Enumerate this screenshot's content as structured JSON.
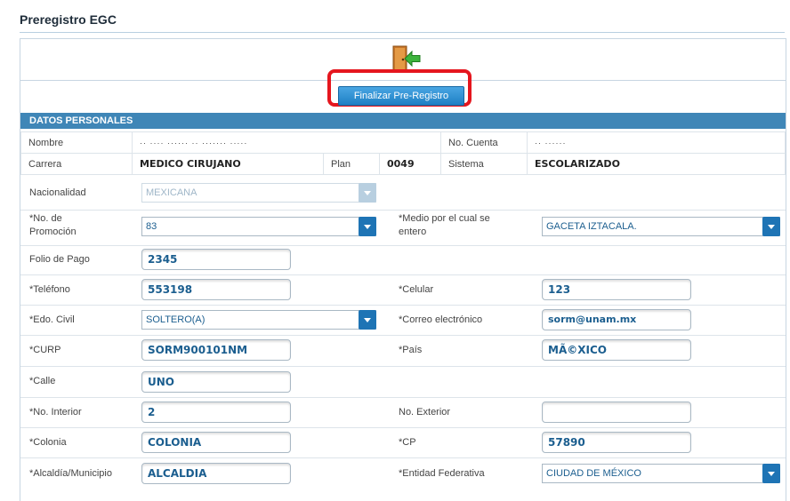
{
  "page": {
    "title": "Preregistro EGC"
  },
  "actions": {
    "finalize_label": "Finalizar Pre-Registro",
    "exit_icon": "exit-door-icon"
  },
  "section": {
    "title": "DATOS PERSONALES"
  },
  "info": {
    "nombre_label": "Nombre",
    "nombre_value": "·· ···· ······ ·· ······· ·····",
    "cuenta_label": "No. Cuenta",
    "cuenta_value": "·· ······",
    "carrera_label": "Carrera",
    "carrera_value": "MEDICO CIRUJANO",
    "plan_label": "Plan",
    "plan_value": "0049",
    "sistema_label": "Sistema",
    "sistema_value": "ESCOLARIZADO"
  },
  "form": {
    "nacionalidad": {
      "label": "Nacionalidad",
      "value": "MEXICANA"
    },
    "promocion": {
      "label_1": "*No. de",
      "label_2": "Promoción",
      "value": "83"
    },
    "medio": {
      "label_1": "*Medio por el cual se",
      "label_2": "entero",
      "value": "GACETA IZTACALA."
    },
    "folio": {
      "label": "Folio de Pago",
      "value": "2345"
    },
    "telefono": {
      "label": "*Teléfono",
      "value": "553198"
    },
    "celular": {
      "label": "*Celular",
      "value": "123"
    },
    "edo_civil": {
      "label": "*Edo. Civil",
      "value": "SOLTERO(A)"
    },
    "correo": {
      "label": "*Correo electrónico",
      "value": "sorm@unam.mx"
    },
    "curp": {
      "label": "*CURP",
      "value": "SORM900101NM"
    },
    "pais": {
      "label": "*País",
      "value": "MÃ©XICO"
    },
    "calle": {
      "label": "*Calle",
      "value": "UNO"
    },
    "no_interior": {
      "label": "*No. Interior",
      "value": "2"
    },
    "no_exterior": {
      "label": "No. Exterior",
      "value": ""
    },
    "colonia": {
      "label": "*Colonia",
      "value": "COLONIA"
    },
    "cp": {
      "label": "*CP",
      "value": "57890"
    },
    "alcaldia": {
      "label": "*Alcaldía/Municipio",
      "value": "ALCALDIA"
    },
    "entidad": {
      "label": "*Entidad Federativa",
      "value": "CIUDAD DE MÉXICO"
    }
  },
  "colors": {
    "section_bar": "#3f86b7",
    "highlight": "#e5161e",
    "button": "#1d7fc4"
  }
}
